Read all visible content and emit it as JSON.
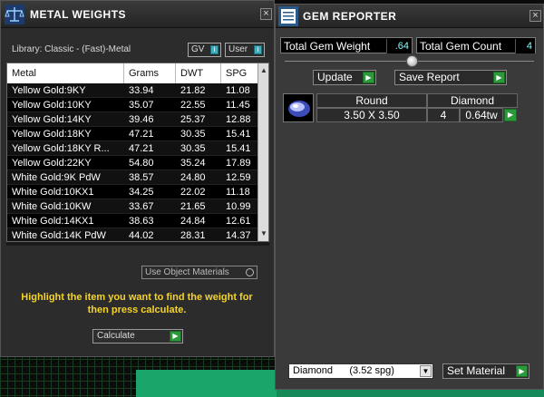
{
  "metal_panel": {
    "title": "METAL WEIGHTS",
    "library_label": "Library: Classic - (Fast)-Metal",
    "gv_label": "GV",
    "user_label": "User",
    "columns": [
      "Metal",
      "Grams",
      "DWT",
      "SPG"
    ],
    "rows": [
      {
        "metal": "Yellow Gold:9KY",
        "grams": "33.94",
        "dwt": "21.82",
        "spg": "11.08"
      },
      {
        "metal": "Yellow Gold:10KY",
        "grams": "35.07",
        "dwt": "22.55",
        "spg": "11.45"
      },
      {
        "metal": "Yellow Gold:14KY",
        "grams": "39.46",
        "dwt": "25.37",
        "spg": "12.88"
      },
      {
        "metal": "Yellow Gold:18KY",
        "grams": "47.21",
        "dwt": "30.35",
        "spg": "15.41"
      },
      {
        "metal": "Yellow Gold:18KY R...",
        "grams": "47.21",
        "dwt": "30.35",
        "spg": "15.41"
      },
      {
        "metal": "Yellow Gold:22KY",
        "grams": "54.80",
        "dwt": "35.24",
        "spg": "17.89"
      },
      {
        "metal": "White Gold:9K PdW",
        "grams": "38.57",
        "dwt": "24.80",
        "spg": "12.59"
      },
      {
        "metal": "White Gold:10KX1",
        "grams": "34.25",
        "dwt": "22.02",
        "spg": "11.18"
      },
      {
        "metal": "White Gold:10KW",
        "grams": "33.67",
        "dwt": "21.65",
        "spg": "10.99"
      },
      {
        "metal": "White Gold:14KX1",
        "grams": "38.63",
        "dwt": "24.84",
        "spg": "12.61"
      },
      {
        "metal": "White Gold:14K PdW",
        "grams": "44.02",
        "dwt": "28.31",
        "spg": "14.37"
      }
    ],
    "use_object_materials": "Use Object Materials",
    "hint": "Highlight the item you want to find the weight for then press calculate.",
    "calculate_label": "Calculate"
  },
  "gem_panel": {
    "title": "GEM REPORTER",
    "total_weight_label": "Total Gem Weight",
    "total_weight_value": ".64",
    "total_count_label": "Total Gem Count",
    "total_count_value": "4",
    "update_label": "Update",
    "save_report_label": "Save Report",
    "gem": {
      "shape": "Round",
      "material": "Diamond",
      "size": "3.50 X 3.50",
      "count": "4",
      "weight": "0.64tw"
    },
    "material_select": "Diamond      (3.52 spg)",
    "set_material_label": "Set Material"
  },
  "colors": {
    "accent_green": "#2a9a3a",
    "hint_yellow": "#f5d328",
    "toggle_cyan": "#3ab0c0"
  }
}
